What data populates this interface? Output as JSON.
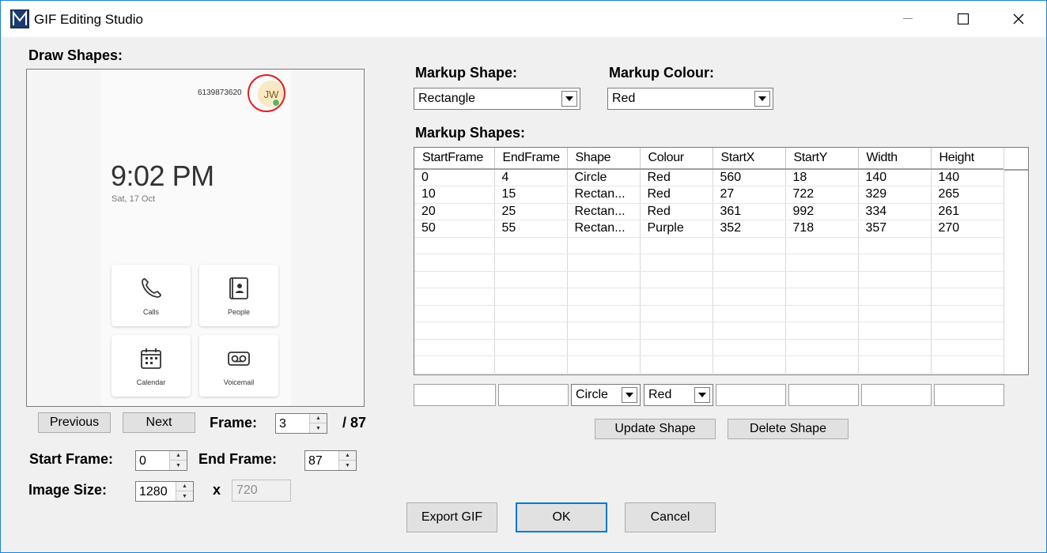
{
  "window": {
    "title": "GIF Editing Studio",
    "icon": "app-logo-icon"
  },
  "preview": {
    "label": "Draw Shapes:",
    "phone_number": "6139873620",
    "avatar_initials": "JW",
    "time": "9:02 PM",
    "date": "Sat, 17 Oct",
    "tiles": [
      {
        "label": "Calls",
        "icon": "phone-icon"
      },
      {
        "label": "People",
        "icon": "contact-card-icon"
      },
      {
        "label": "Calendar",
        "icon": "calendar-icon"
      },
      {
        "label": "Voicemail",
        "icon": "voicemail-icon"
      }
    ],
    "markup_color": "#e02020"
  },
  "navigation": {
    "previous_label": "Previous",
    "next_label": "Next",
    "frame_label": "Frame:",
    "frame_value": "3",
    "frame_total": "/ 87"
  },
  "range": {
    "start_label": "Start Frame:",
    "start_value": "0",
    "end_label": "End Frame:",
    "end_value": "87"
  },
  "size": {
    "label": "Image Size:",
    "width": "1280",
    "x_label": "x",
    "height": "720"
  },
  "markup": {
    "shape_label": "Markup Shape:",
    "shape_value": "Rectangle",
    "colour_label": "Markup Colour:",
    "colour_value": "Red"
  },
  "shapes_table": {
    "label": "Markup Shapes:",
    "columns": [
      "StartFrame",
      "EndFrame",
      "Shape",
      "Colour",
      "StartX",
      "StartY",
      "Width",
      "Height"
    ],
    "rows": [
      [
        "0",
        "4",
        "Circle",
        "Red",
        "560",
        "18",
        "140",
        "140"
      ],
      [
        "10",
        "15",
        "Rectan...",
        "Red",
        "27",
        "722",
        "329",
        "265"
      ],
      [
        "20",
        "25",
        "Rectan...",
        "Red",
        "361",
        "992",
        "334",
        "261"
      ],
      [
        "50",
        "55",
        "Rectan...",
        "Purple",
        "352",
        "718",
        "357",
        "270"
      ]
    ],
    "empty_rows": 8
  },
  "editor": {
    "shape_value": "Circle",
    "colour_value": "Red"
  },
  "actions": {
    "update_label": "Update Shape",
    "delete_label": "Delete Shape",
    "export_label": "Export GIF",
    "ok_label": "OK",
    "cancel_label": "Cancel"
  }
}
